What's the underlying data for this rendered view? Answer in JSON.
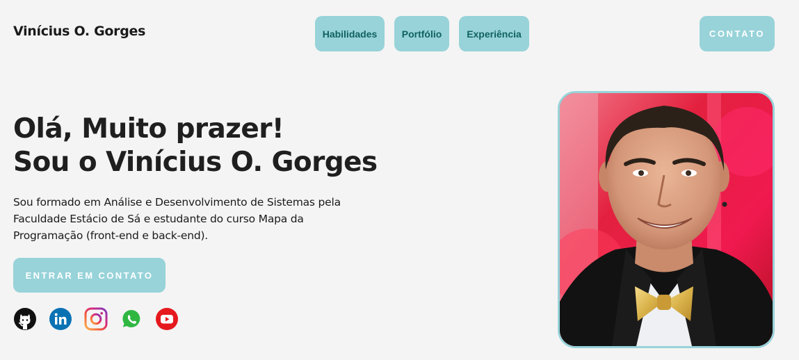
{
  "header": {
    "brand": "Vinícius O. Gorges",
    "nav": [
      {
        "label": "Habilidades"
      },
      {
        "label": "Portfólio"
      },
      {
        "label": "Experiência"
      }
    ],
    "contact_label": "CONTATO"
  },
  "hero": {
    "title_line1": "Olá, Muito prazer!",
    "title_line2": "Sou o Vinícius O. Gorges",
    "description": "Sou formado em Análise e Desenvolvimento de Sistemas pela Faculdade Estácio de Sá e estudante do curso Mapa da Programação (front-end e back-end).",
    "cta_label": "ENTRAR EM CONTATO"
  },
  "socials": [
    {
      "icon": "github-icon"
    },
    {
      "icon": "linkedin-icon"
    },
    {
      "icon": "instagram-icon"
    },
    {
      "icon": "whatsapp-icon"
    },
    {
      "icon": "youtube-icon"
    }
  ],
  "colors": {
    "accent": "#97d3d9",
    "nav_text": "#11615f",
    "background": "#f4f4f4",
    "text": "#1a1a1a"
  }
}
